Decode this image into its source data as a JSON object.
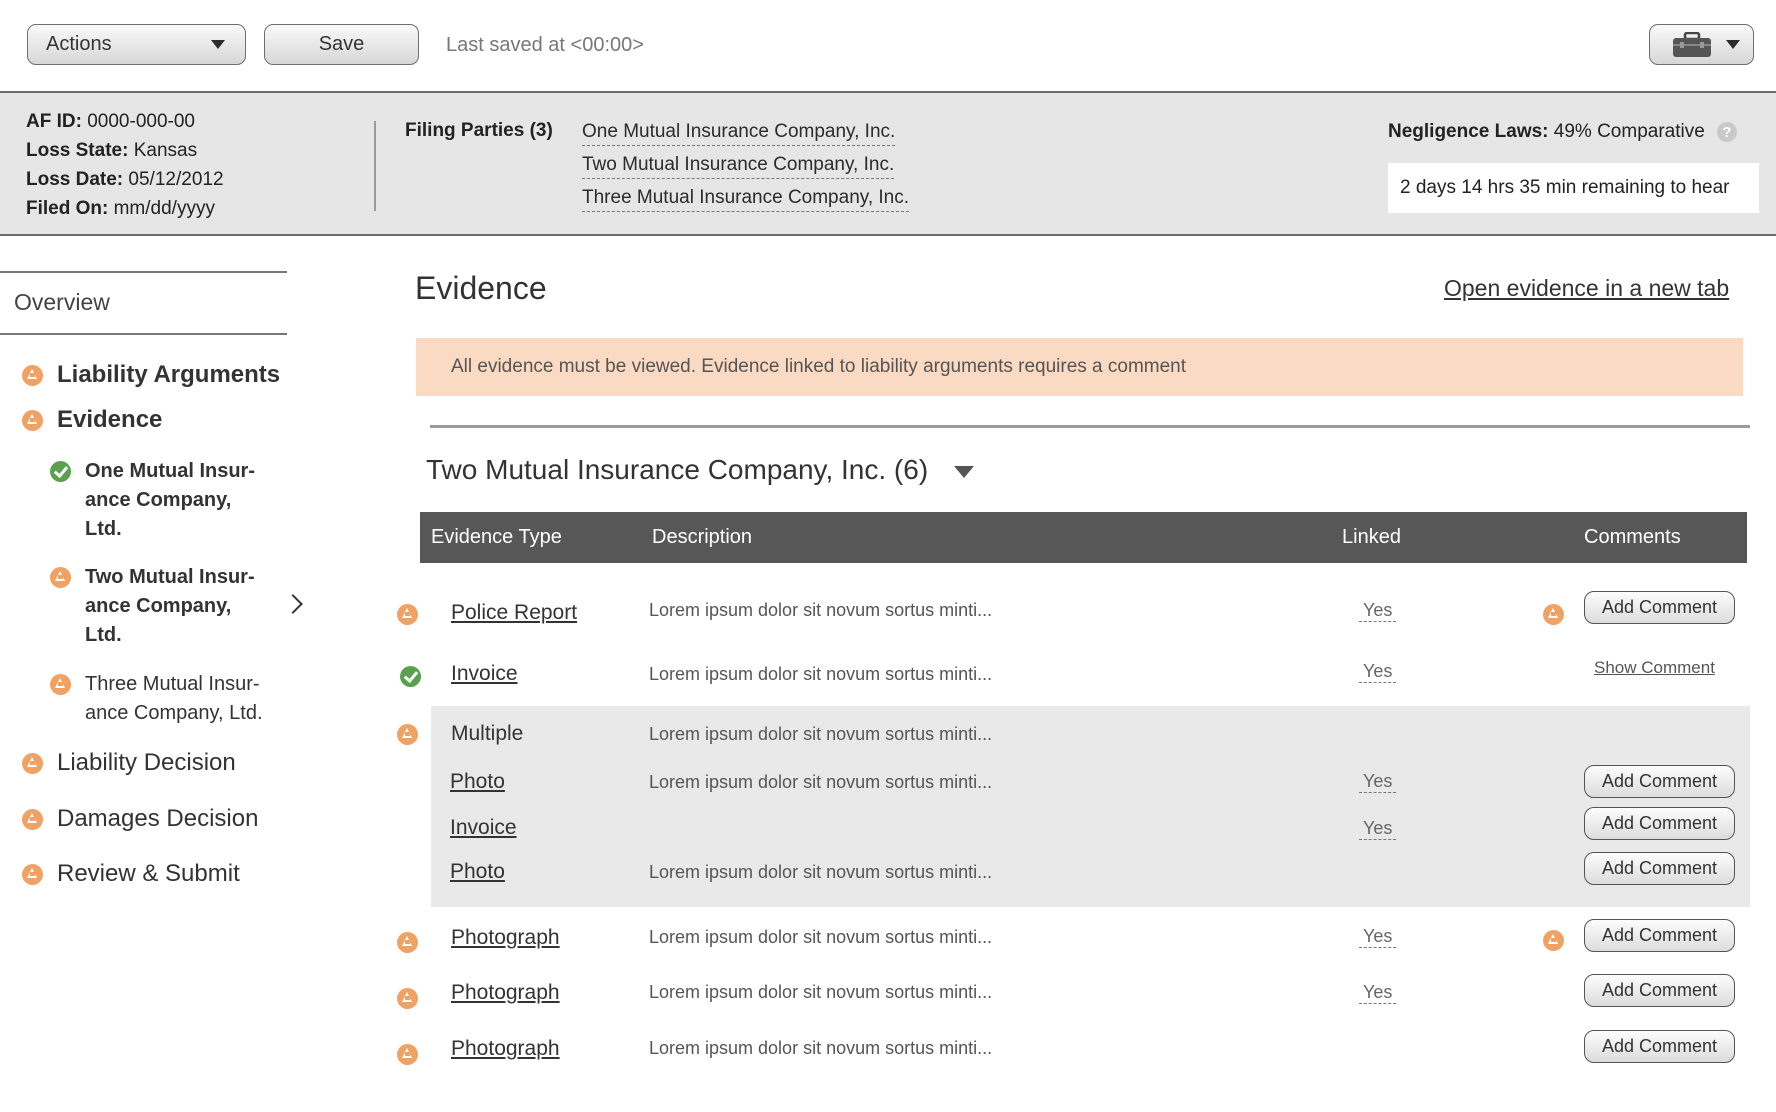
{
  "toolbar": {
    "actions_label": "Actions",
    "save_label": "Save",
    "last_saved": "Last saved at <00:00>"
  },
  "info": {
    "af_id_label": "AF ID:",
    "af_id": "0000-000-00",
    "loss_state_label": "Loss State:",
    "loss_state": "Kansas",
    "loss_date_label": "Loss Date:",
    "loss_date": "05/12/2012",
    "filed_on_label": "Filed On:",
    "filed_on": "mm/dd/yyyy",
    "filing_parties_label": "Filing Parties (3)",
    "filing_parties": [
      "One Mutual Insurance Company, Inc.",
      "Two Mutual Insurance Company, Inc.",
      "Three Mutual Insurance Company, Inc."
    ],
    "negligence_label": "Negligence Laws:",
    "negligence_value": "49% Comparative",
    "help": "?",
    "timer": "2 days 14 hrs 35 min remaining to hear"
  },
  "sidebar": {
    "overview": "Overview",
    "items": [
      {
        "label": "Liability Arguments",
        "status": "warning"
      },
      {
        "label": "Evidence",
        "status": "warning"
      },
      {
        "label": "One Mutual Insur-\nance Company,\nLtd.",
        "status": "ok"
      },
      {
        "label": "Two Mutual Insur-\nance Company,\nLtd.",
        "status": "warning"
      },
      {
        "label": "Three Mutual Insur-\nance Company, Ltd.",
        "status": "warning"
      },
      {
        "label": "Liability Decision",
        "status": "warning"
      },
      {
        "label": "Damages Decision",
        "status": "warning"
      },
      {
        "label": "Review & Submit",
        "status": "warning"
      }
    ]
  },
  "main": {
    "title": "Evidence",
    "open_link": "Open evidence in a new tab",
    "alert": "All evidence must be viewed. Evidence linked to liability arguments requires a comment",
    "company": "Two Mutual Insurance Company, Inc. (6)",
    "columns": [
      "Evidence Type",
      "Description",
      "Linked",
      "Comments"
    ],
    "rows": [
      {
        "type": "Police Report",
        "desc": "Lorem ipsum dolor sit novum sortus minti...",
        "linked": "Yes",
        "comment": "Add Comment",
        "status": "warning",
        "comment_warning": true
      },
      {
        "type": "Invoice",
        "desc": "Lorem ipsum dolor sit novum sortus minti...",
        "linked": "Yes",
        "comment": "Show Comment",
        "status": "ok"
      },
      {
        "type": "Multiple",
        "desc": "Lorem ipsum dolor sit novum sortus minti...",
        "status": "warning"
      },
      {
        "type": "Photo",
        "desc": "Lorem ipsum dolor sit novum sortus minti...",
        "linked": "Yes",
        "comment": "Add Comment"
      },
      {
        "type": "Invoice",
        "desc": "",
        "linked": "Yes",
        "comment": "Add Comment"
      },
      {
        "type": "Photo",
        "desc": "Lorem ipsum dolor sit novum sortus minti...",
        "comment": "Add Comment"
      },
      {
        "type": "Photograph",
        "desc": "Lorem ipsum dolor sit novum sortus minti...",
        "linked": "Yes",
        "comment": "Add Comment",
        "status": "warning",
        "comment_warning": true
      },
      {
        "type": "Photograph",
        "desc": "Lorem ipsum dolor sit novum sortus minti...",
        "linked": "Yes",
        "comment": "Add Comment",
        "status": "warning"
      },
      {
        "type": "Photograph",
        "desc": "Lorem ipsum dolor sit novum sortus minti...",
        "comment": "Add Comment",
        "status": "warning"
      }
    ]
  }
}
